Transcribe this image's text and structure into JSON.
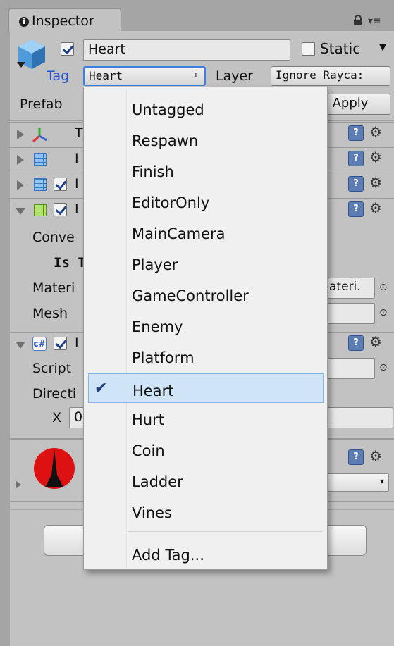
{
  "tab": {
    "icon": "info-icon",
    "title": "Inspector"
  },
  "header": {
    "active": true,
    "name": "Heart",
    "static_label": "Static",
    "static_checked": false,
    "tag_label": "Tag",
    "tag_value": "Heart",
    "layer_label": "Layer",
    "layer_value": "Ignore Rayca:",
    "prefab_label": "Prefab",
    "apply_label": "Apply"
  },
  "components": [
    {
      "icon": "transform-icon",
      "label": "T"
    },
    {
      "icon": "mesh-filter-icon",
      "label": "I"
    },
    {
      "icon": "mesh-renderer-icon",
      "label": "I"
    },
    {
      "icon": "mesh-collider-icon",
      "label": "I"
    },
    {
      "icon": "script-icon",
      "label": "I"
    }
  ],
  "collider": {
    "convex_label": "Conve",
    "is_trigger_label": "Is T",
    "material_label": "Materi",
    "material_value": "ateri.",
    "mesh_label": "Mesh"
  },
  "script": {
    "script_label": "Script",
    "direction_label": "Directi",
    "x_label": "X",
    "x_value": "0"
  },
  "dropdown": {
    "items": [
      "Untagged",
      "Respawn",
      "Finish",
      "EditorOnly",
      "MainCamera",
      "Player",
      "GameController",
      "Enemy",
      "Platform",
      "Heart",
      "Hurt",
      "Coin",
      "Ladder",
      "Vines"
    ],
    "selected": "Heart",
    "add_tag": "Add Tag..."
  },
  "colors": {
    "accent": "#3d7ee0",
    "selection": "#cfe4f7",
    "panel": "#c2c2c2"
  }
}
